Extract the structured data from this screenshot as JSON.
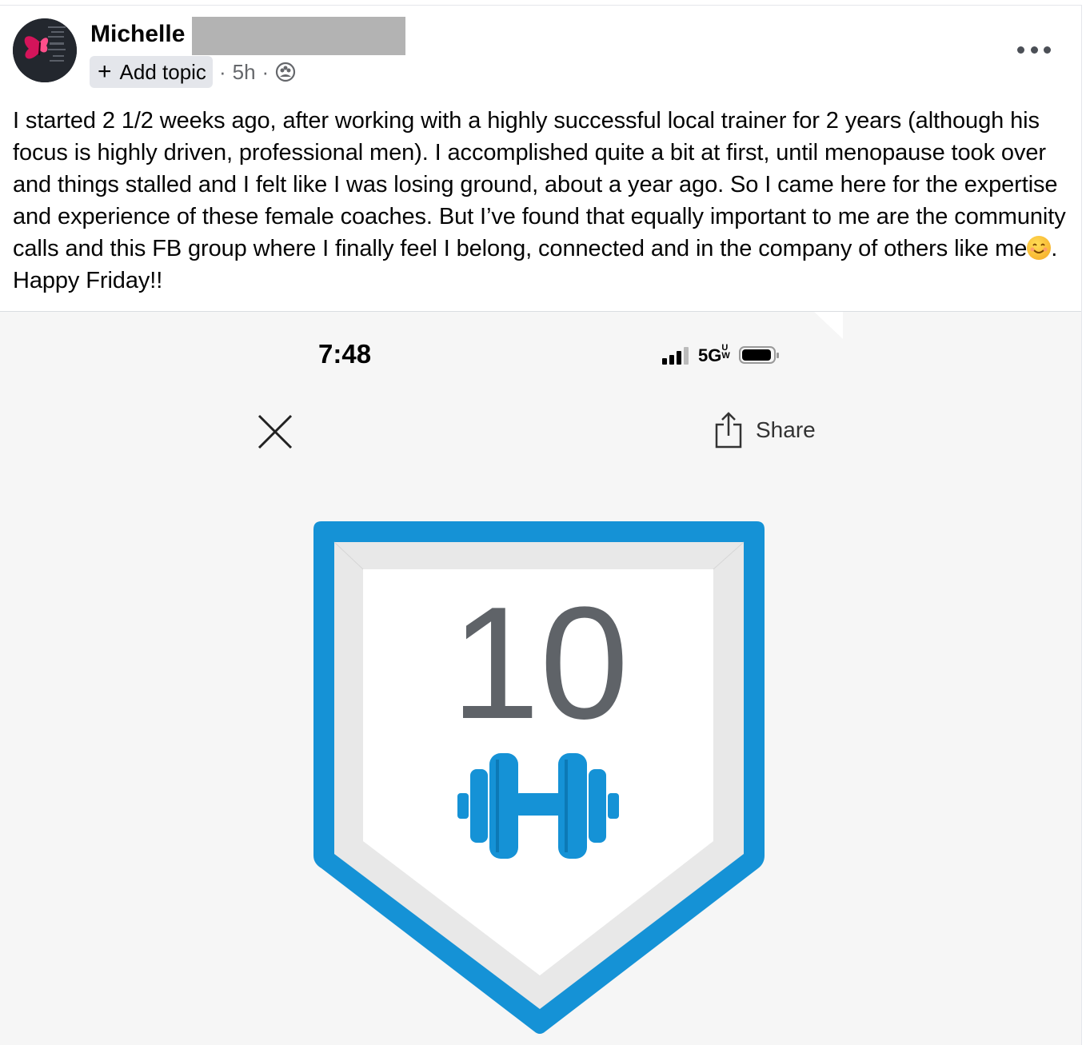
{
  "post": {
    "author": "Michelle",
    "add_topic_label": "Add topic",
    "time_ago": "5h",
    "separator": "·",
    "body_text": "I started 2 1/2 weeks ago, after working with a highly successful local trainer for 2 years (although his focus is highly driven, professional men). I accomplished quite a bit at first, until menopause took over and things stalled and I felt like I was losing ground, about a year ago. So I came here for the expertise and experience of these female coaches. But I’ve found that equally important to me are the community calls and this FB group where I finally feel I belong, connected and in the company of others like me",
    "body_text_end": ". Happy Friday!!",
    "emoji": "smiling-face-icon",
    "privacy_icon": "group-icon"
  },
  "phone_screenshot": {
    "time": "7:48",
    "network": "5G",
    "network_suffix": "UW",
    "share_label": "Share",
    "badge_number": "10",
    "badge_icon": "dumbbell-icon",
    "colors": {
      "badge_blue": "#1592d6",
      "badge_inner": "#ffffff",
      "badge_bevel": "#e8e8e8",
      "number_gray": "#5f6368",
      "background": "#f6f6f6"
    }
  }
}
